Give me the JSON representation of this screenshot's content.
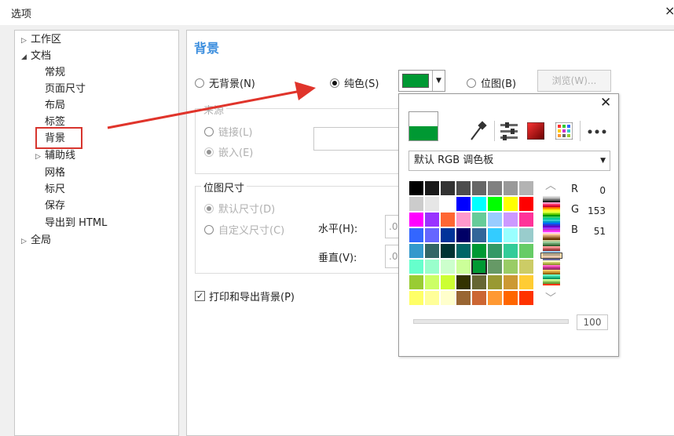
{
  "window": {
    "title": "选项",
    "close_glyph": "×"
  },
  "tree": {
    "items": [
      {
        "label": "工作区",
        "arrow": "▷"
      },
      {
        "label": "文档",
        "arrow": "◢"
      },
      {
        "label": "常规"
      },
      {
        "label": "页面尺寸"
      },
      {
        "label": "布局"
      },
      {
        "label": "标签"
      },
      {
        "label": "背景"
      },
      {
        "label": "辅助线",
        "arrow": "▷"
      },
      {
        "label": "网格"
      },
      {
        "label": "标尺"
      },
      {
        "label": "保存"
      },
      {
        "label": "导出到 HTML"
      },
      {
        "label": "全局",
        "arrow": "▷"
      }
    ],
    "selected": "背景",
    "highlight_color": "#d7352e"
  },
  "section": {
    "title": "背景",
    "title_color": "#3b8ede"
  },
  "background_type": {
    "options": [
      "无背景(N)",
      "纯色(S)",
      "位图(B)"
    ],
    "selected": "纯色(S)",
    "browse_label": "浏览(W)..."
  },
  "source_group": {
    "label": "来源",
    "options": [
      "链接(L)",
      "嵌入(E)"
    ],
    "selected": "嵌入(E)"
  },
  "bitmap_size_group": {
    "label": "位图尺寸",
    "options": [
      "默认尺寸(D)",
      "自定义尺寸(C)"
    ],
    "selected": "默认尺寸(D)",
    "horizontal_label": "水平(H):",
    "vertical_label": "垂直(V):",
    "horizontal_value": ".0",
    "vertical_value": ".0"
  },
  "print_export": {
    "label": "打印和导出背景(P)",
    "checked": true,
    "check_glyph": "✓"
  },
  "color_picker": {
    "current_color": "#009933",
    "close_glyph": "✕",
    "palette_name": "默认 RGB 调色板",
    "r_label": "R",
    "g_label": "G",
    "b_label": "B",
    "r": "0",
    "g": "153",
    "b": "51",
    "opacity_value": "100",
    "tools": [
      "eyedropper-icon",
      "color-sliders-icon",
      "color-model-icon",
      "palette-grid-icon",
      "more-icon"
    ],
    "selected_swatch_index": 44,
    "swatches": [
      "#000000",
      "#1a1a1a",
      "#333333",
      "#4d4d4d",
      "#666666",
      "#808080",
      "#999999",
      "#b3b3b3",
      "#cccccc",
      "#e6e6e6",
      "#ffffff",
      "#0000ff",
      "#00ffff",
      "#00ff00",
      "#ffff00",
      "#ff0000",
      "#ff00ff",
      "#9933ff",
      "#ff6633",
      "#ff99cc",
      "#66cc99",
      "#99ccff",
      "#cc99ff",
      "#ff3399",
      "#3366ff",
      "#6666ff",
      "#003399",
      "#000066",
      "#336699",
      "#33ccff",
      "#99ffff",
      "#99cccc",
      "#3399cc",
      "#336666",
      "#003333",
      "#006666",
      "#009933",
      "#339966",
      "#33cc99",
      "#66cc66",
      "#66ffcc",
      "#99ffcc",
      "#ccffcc",
      "#ccff99",
      "#009933",
      "#669966",
      "#99cc66",
      "#cccc66",
      "#99cc33",
      "#ccff66",
      "#ccff33",
      "#333300",
      "#666633",
      "#999933",
      "#cc9933",
      "#ffcc33",
      "#ffff66",
      "#ffff99",
      "#ffffcc",
      "#996633",
      "#cc6633",
      "#ff9933",
      "#ff6600",
      "#ff3300"
    ]
  }
}
